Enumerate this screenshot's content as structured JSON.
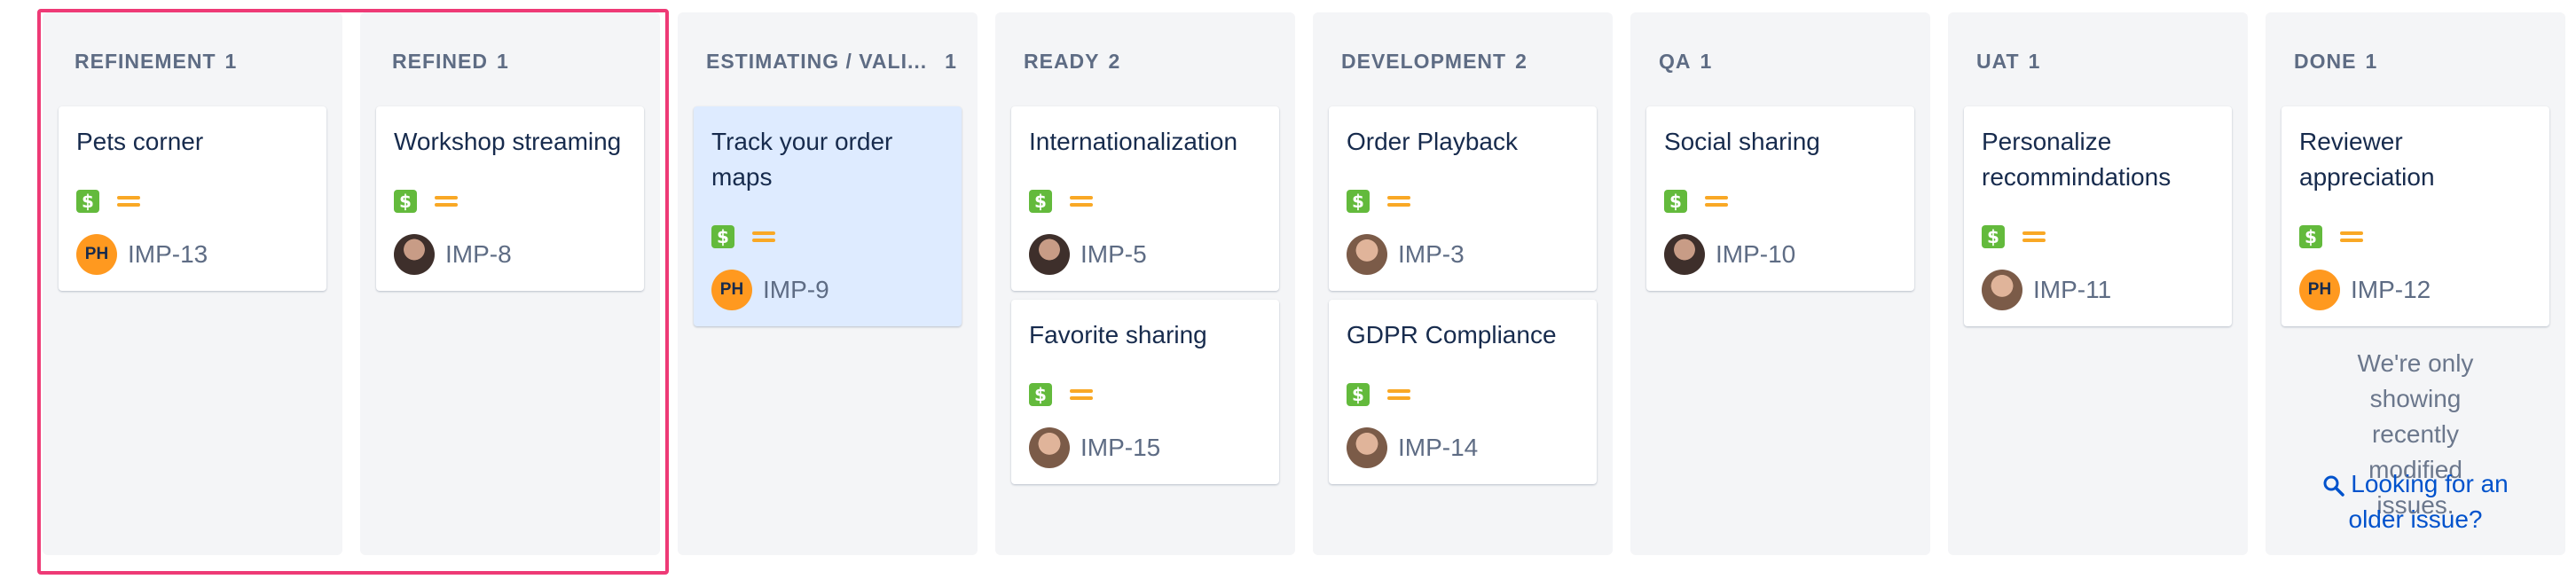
{
  "columns": [
    {
      "name": "REFINEMENT",
      "count": "1"
    },
    {
      "name": "REFINED",
      "count": "1"
    },
    {
      "name": "ESTIMATING / VALI...",
      "count": "1"
    },
    {
      "name": "READY",
      "count": "2"
    },
    {
      "name": "DEVELOPMENT",
      "count": "2"
    },
    {
      "name": "QA",
      "count": "1"
    },
    {
      "name": "UAT",
      "count": "1"
    },
    {
      "name": "DONE",
      "count": "1"
    }
  ],
  "cards": {
    "imp13": {
      "title": "Pets corner",
      "key": "IMP-13",
      "avatar": "PH"
    },
    "imp8": {
      "title": "Workshop streaming",
      "key": "IMP-8"
    },
    "imp9": {
      "title": "Track your order maps",
      "key": "IMP-9",
      "avatar": "PH"
    },
    "imp5": {
      "title": "Internationalization",
      "key": "IMP-5"
    },
    "imp15": {
      "title": "Favorite sharing",
      "key": "IMP-15"
    },
    "imp3": {
      "title": "Order Playback",
      "key": "IMP-3"
    },
    "imp14": {
      "title": "GDPR Compliance",
      "key": "IMP-14"
    },
    "imp10": {
      "title": "Social sharing",
      "key": "IMP-10"
    },
    "imp11": {
      "title": "Personalize recommindations",
      "key": "IMP-11"
    },
    "imp12": {
      "title": "Reviewer appreciation",
      "key": "IMP-12",
      "avatar": "PH"
    }
  },
  "badge_symbol": "$",
  "done_note": "We're only showing recently modified issues.",
  "older_issue_link": "Looking for an older issue?",
  "colors": {
    "highlight": "#ee3a76",
    "selected_card": "#deebff",
    "dollar_badge": "#63ba3c",
    "priority": "#f9a825",
    "initials_avatar": "#ff991f",
    "link": "#0052cc"
  },
  "icons": {
    "badge": "dollar-icon",
    "priority": "priority-medium-icon",
    "search": "search-icon"
  }
}
